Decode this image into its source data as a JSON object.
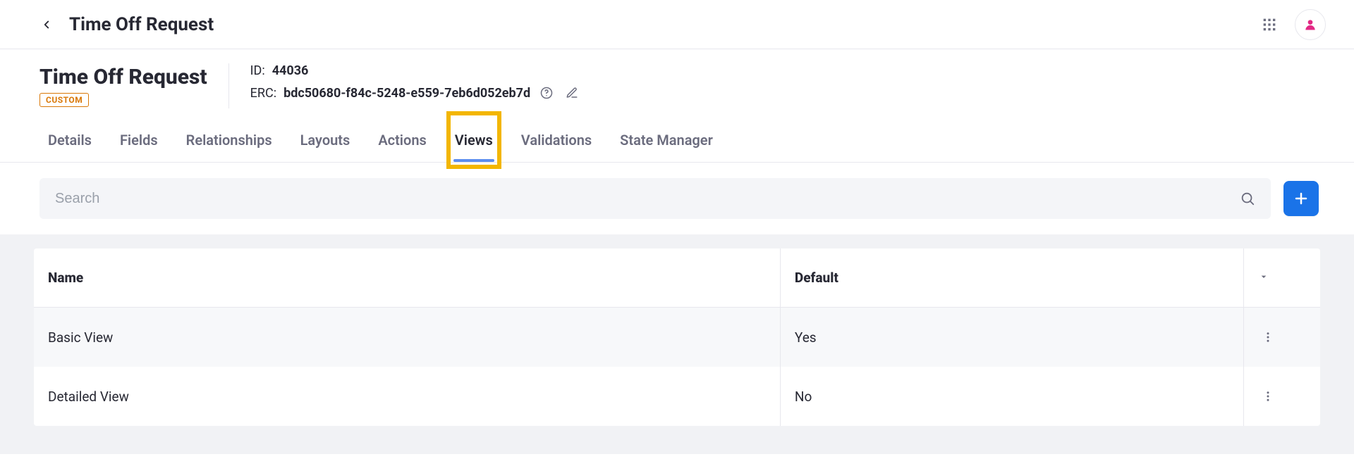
{
  "topbar": {
    "title": "Time Off Request"
  },
  "header": {
    "title": "Time Off Request",
    "badge": "CUSTOM",
    "id_label": "ID:",
    "id_value": "44036",
    "erc_label": "ERC:",
    "erc_value": "bdc50680-f84c-5248-e559-7eb6d052eb7d"
  },
  "tabs": [
    {
      "label": "Details",
      "active": false
    },
    {
      "label": "Fields",
      "active": false
    },
    {
      "label": "Relationships",
      "active": false
    },
    {
      "label": "Layouts",
      "active": false
    },
    {
      "label": "Actions",
      "active": false
    },
    {
      "label": "Views",
      "active": true,
      "highlight": true
    },
    {
      "label": "Validations",
      "active": false
    },
    {
      "label": "State Manager",
      "active": false
    }
  ],
  "toolbar": {
    "search_placeholder": "Search"
  },
  "table": {
    "columns": {
      "name": "Name",
      "default": "Default"
    },
    "rows": [
      {
        "name": "Basic View",
        "default": "Yes"
      },
      {
        "name": "Detailed View",
        "default": "No"
      }
    ]
  }
}
